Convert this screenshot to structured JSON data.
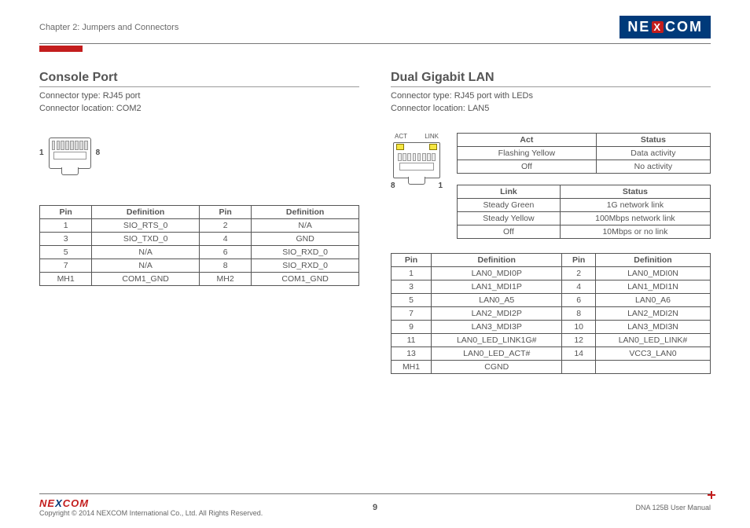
{
  "header": {
    "chapter": "Chapter 2: Jumpers and Connectors",
    "logo_text_pre": "NE",
    "logo_text_x": "X",
    "logo_text_post": "COM"
  },
  "console": {
    "title": "Console Port",
    "conn_type": "Connector type: RJ45 port",
    "conn_loc": "Connector location: COM2",
    "pin_left": "1",
    "pin_right": "8",
    "headers": {
      "pin": "Pin",
      "def": "Definition"
    },
    "rows": [
      {
        "p1": "1",
        "d1": "SIO_RTS_0",
        "p2": "2",
        "d2": "N/A"
      },
      {
        "p1": "3",
        "d1": "SIO_TXD_0",
        "p2": "4",
        "d2": "GND"
      },
      {
        "p1": "5",
        "d1": "N/A",
        "p2": "6",
        "d2": "SIO_RXD_0"
      },
      {
        "p1": "7",
        "d1": "N/A",
        "p2": "8",
        "d2": "SIO_RXD_0"
      },
      {
        "p1": "MH1",
        "d1": "COM1_GND",
        "p2": "MH2",
        "d2": "COM1_GND"
      }
    ]
  },
  "lan": {
    "title": "Dual Gigabit LAN",
    "conn_type": "Connector type: RJ45 port with LEDs",
    "conn_loc": "Connector location: LAN5",
    "led_act": "ACT",
    "led_link": "LINK",
    "pin_left": "8",
    "pin_right": "1",
    "act_table": {
      "headers": {
        "a": "Act",
        "s": "Status"
      },
      "rows": [
        {
          "a": "Flashing Yellow",
          "s": "Data activity"
        },
        {
          "a": "Off",
          "s": "No activity"
        }
      ]
    },
    "link_table": {
      "headers": {
        "a": "Link",
        "s": "Status"
      },
      "rows": [
        {
          "a": "Steady Green",
          "s": "1G network link"
        },
        {
          "a": "Steady Yellow",
          "s": "100Mbps network link"
        },
        {
          "a": "Off",
          "s": "10Mbps or no link"
        }
      ]
    },
    "pin_table": {
      "headers": {
        "pin": "Pin",
        "def": "Definition"
      },
      "rows": [
        {
          "p1": "1",
          "d1": "LAN0_MDI0P",
          "p2": "2",
          "d2": "LAN0_MDI0N"
        },
        {
          "p1": "3",
          "d1": "LAN1_MDI1P",
          "p2": "4",
          "d2": "LAN1_MDI1N"
        },
        {
          "p1": "5",
          "d1": "LAN0_A5",
          "p2": "6",
          "d2": "LAN0_A6"
        },
        {
          "p1": "7",
          "d1": "LAN2_MDI2P",
          "p2": "8",
          "d2": "LAN2_MDI2N"
        },
        {
          "p1": "9",
          "d1": "LAN3_MDI3P",
          "p2": "10",
          "d2": "LAN3_MDI3N"
        },
        {
          "p1": "11",
          "d1": "LAN0_LED_LINK1G#",
          "p2": "12",
          "d2": "LAN0_LED_LINK#"
        },
        {
          "p1": "13",
          "d1": "LAN0_LED_ACT#",
          "p2": "14",
          "d2": "VCC3_LAN0"
        },
        {
          "p1": "MH1",
          "d1": "CGND",
          "p2": "",
          "d2": ""
        }
      ]
    }
  },
  "footer": {
    "logo_pre": "NE",
    "logo_x": "X",
    "logo_post": "COM",
    "copyright": "Copyright © 2014 NEXCOM International Co., Ltd. All Rights Reserved.",
    "page": "9",
    "doc": "DNA 125B User Manual"
  }
}
